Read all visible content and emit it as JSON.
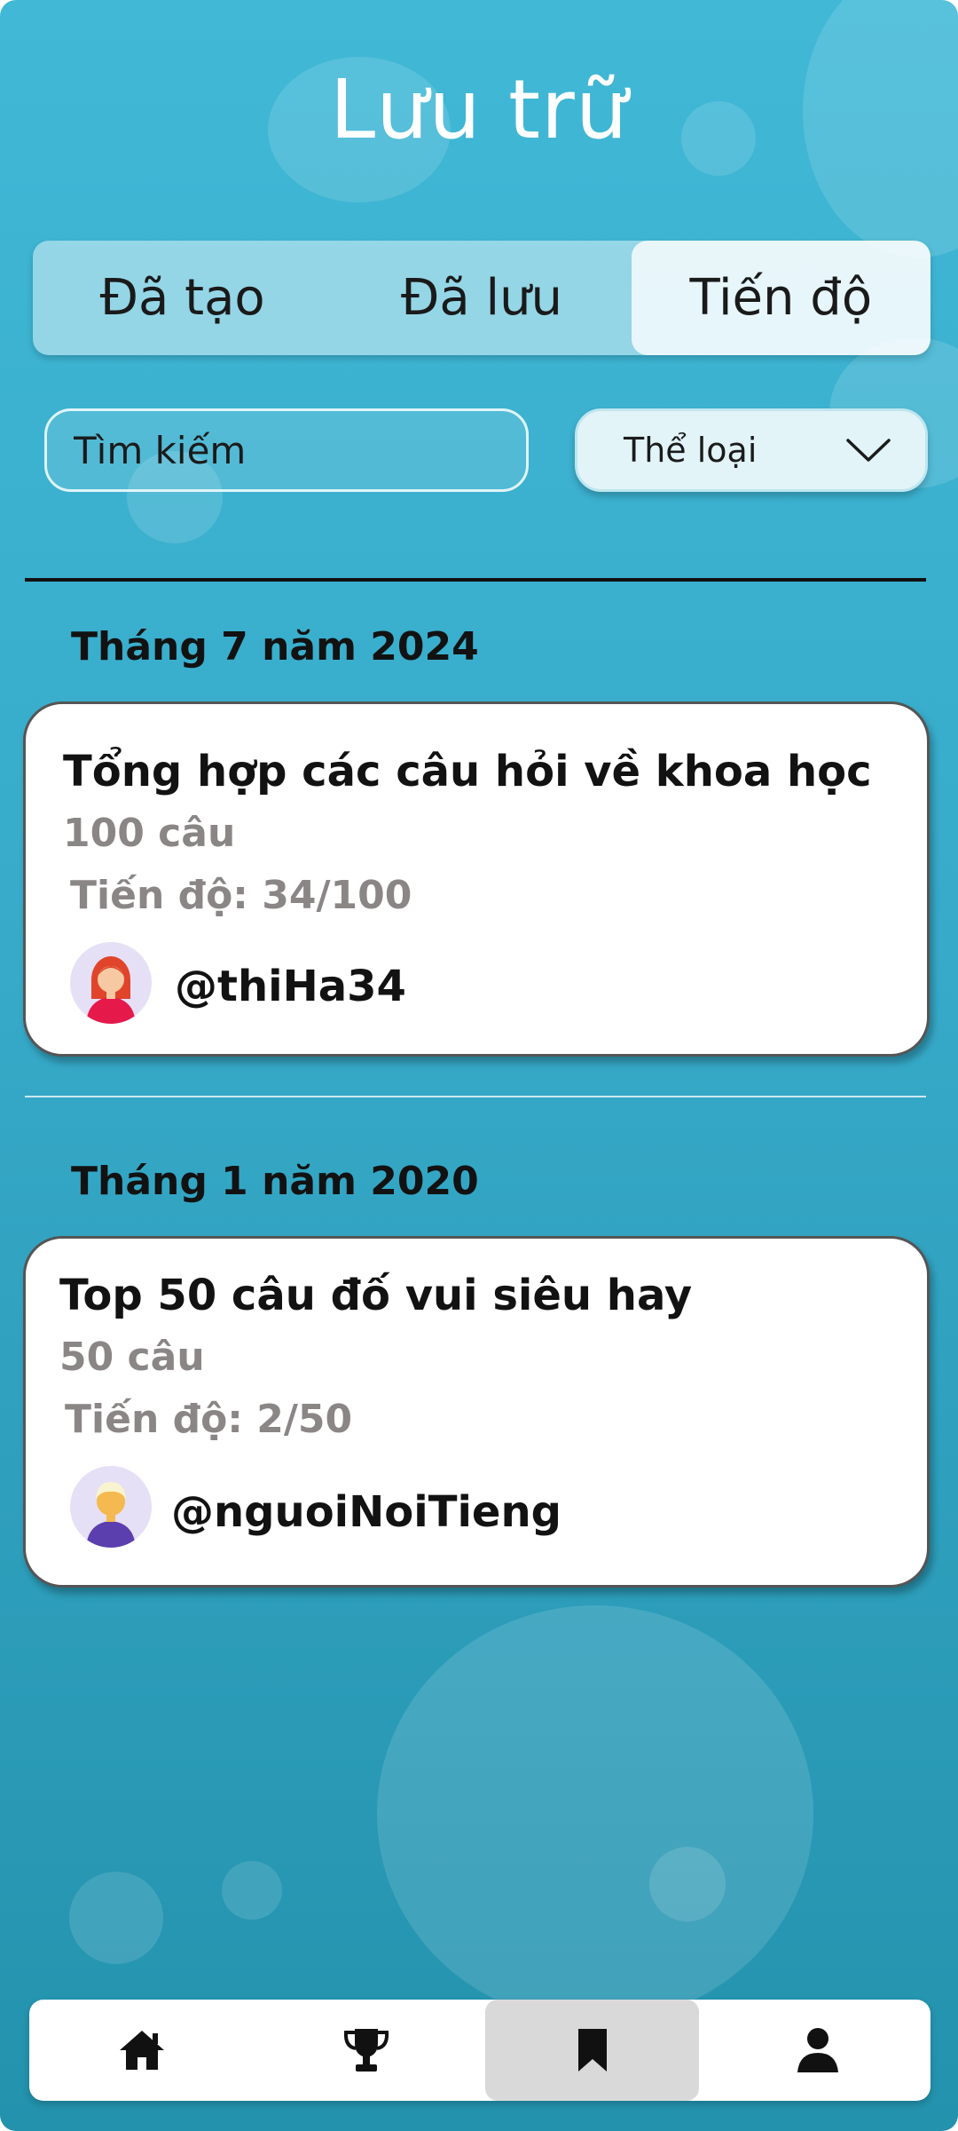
{
  "header": {
    "title": "Lưu trữ"
  },
  "tabs": [
    {
      "label": "Đã tạo",
      "active": false
    },
    {
      "label": "Đã lưu",
      "active": false
    },
    {
      "label": "Tiến độ",
      "active": true
    }
  ],
  "search": {
    "placeholder": "Tìm kiếm"
  },
  "category_filter": {
    "label": "Thể loại",
    "icon": "chevron-down-icon"
  },
  "groups": [
    {
      "month": "Tháng 7 năm 2024",
      "card": {
        "title": "Tổng hợp các câu hỏi về khoa học",
        "question_count": "100 câu",
        "progress": "Tiến độ: 34/100",
        "author": "@thiHa34",
        "avatar_icon": "avatar-red-hair-icon"
      }
    },
    {
      "month": "Tháng 1 năm 2020",
      "card": {
        "title": "Top 50 câu đố vui siêu hay",
        "question_count": "50 câu",
        "progress": "Tiến độ: 2/50",
        "author": "@nguoiNoiTieng",
        "avatar_icon": "avatar-blond-hair-icon"
      }
    }
  ],
  "bottom_nav": [
    {
      "icon": "home-icon",
      "active": false
    },
    {
      "icon": "trophy-icon",
      "active": false
    },
    {
      "icon": "bookmark-icon",
      "active": true
    },
    {
      "icon": "user-icon",
      "active": false
    }
  ],
  "colors": {
    "background_top": "#40b8d6",
    "background_bottom": "#2392ad",
    "card": "#ffffff",
    "meta_text": "#8b8686",
    "nav_active": "#d9d9d9"
  }
}
